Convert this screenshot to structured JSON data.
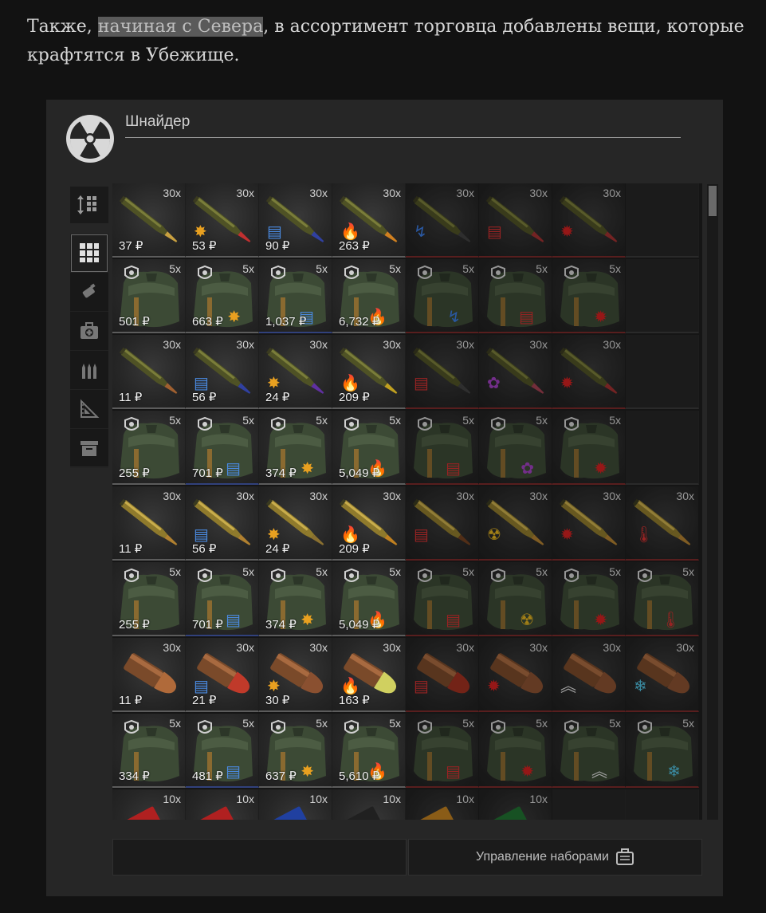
{
  "article": {
    "pre": "Также, ",
    "highlight": "начиная с Севера",
    "post": ", в ассортимент торговца добавлены вещи, которые крафтятся в Убежище."
  },
  "trader": {
    "name": "Шнайдер",
    "logo_icon": "radiation-icon"
  },
  "sidebar": {
    "sort_icon": "sort-grid-icon",
    "categories": [
      {
        "icon": "all-grid-icon",
        "active": true
      },
      {
        "icon": "grenade-icon",
        "active": false
      },
      {
        "icon": "medkit-icon",
        "active": false
      },
      {
        "icon": "ammo-icon",
        "active": false
      },
      {
        "icon": "tools-icon",
        "active": false
      },
      {
        "icon": "box-icon",
        "active": false
      }
    ]
  },
  "grid_rows": [
    {
      "cells": [
        {
          "kind": "cart",
          "qty": "30x",
          "price": "37 ₽",
          "tip": "#c8a040",
          "mod": ""
        },
        {
          "kind": "cart",
          "qty": "30x",
          "price": "53 ₽",
          "tip": "#c03030",
          "mod": "spark"
        },
        {
          "kind": "cart",
          "qty": "30x",
          "price": "90 ₽",
          "tip": "#3040a0",
          "mod": "armor"
        },
        {
          "kind": "cart",
          "qty": "30x",
          "price": "263 ₽",
          "tip": "#d08020",
          "mod": "fire"
        },
        {
          "kind": "cart",
          "qty": "30x",
          "price": "",
          "tip": "#404040",
          "mod": "shock",
          "dim": true
        },
        {
          "kind": "cart",
          "qty": "30x",
          "price": "",
          "tip": "#a03030",
          "mod": "armor-red",
          "dim": true
        },
        {
          "kind": "cart",
          "qty": "30x",
          "price": "",
          "tip": "#a03030",
          "mod": "bleed",
          "dim": true
        },
        {
          "kind": "empty"
        }
      ]
    },
    {
      "cells": [
        {
          "kind": "pack",
          "qty": "5x",
          "price": "501 ₽",
          "mod": ""
        },
        {
          "kind": "pack",
          "qty": "5x",
          "price": "663 ₽",
          "mod": "spark"
        },
        {
          "kind": "pack",
          "qty": "5x",
          "price": "1,037 ₽",
          "mod": "armor"
        },
        {
          "kind": "pack",
          "qty": "5x",
          "price": "6,732 ₽",
          "mod": "fire"
        },
        {
          "kind": "pack",
          "qty": "5x",
          "price": "",
          "mod": "shock",
          "dim": true
        },
        {
          "kind": "pack",
          "qty": "5x",
          "price": "",
          "mod": "armor-red",
          "dim": true
        },
        {
          "kind": "pack",
          "qty": "5x",
          "price": "",
          "mod": "bleed",
          "dim": true
        },
        {
          "kind": "empty"
        }
      ]
    },
    {
      "cells": [
        {
          "kind": "cart",
          "qty": "30x",
          "price": "11 ₽",
          "tip": "#a06030",
          "mod": ""
        },
        {
          "kind": "cart",
          "qty": "30x",
          "price": "56 ₽",
          "tip": "#3040a0",
          "mod": "armor"
        },
        {
          "kind": "cart",
          "qty": "30x",
          "price": "24 ₽",
          "tip": "#6030a0",
          "mod": "spark"
        },
        {
          "kind": "cart",
          "qty": "30x",
          "price": "209 ₽",
          "tip": "#c0a020",
          "mod": "fire"
        },
        {
          "kind": "cart",
          "qty": "30x",
          "price": "",
          "tip": "#404040",
          "mod": "armor-red",
          "dim": true
        },
        {
          "kind": "cart",
          "qty": "30x",
          "price": "",
          "tip": "#a04050",
          "mod": "brain",
          "dim": true
        },
        {
          "kind": "cart",
          "qty": "30x",
          "price": "",
          "tip": "#a03030",
          "mod": "bleed",
          "dim": true
        },
        {
          "kind": "empty"
        }
      ]
    },
    {
      "cells": [
        {
          "kind": "pack",
          "qty": "5x",
          "price": "255 ₽",
          "mod": ""
        },
        {
          "kind": "pack",
          "qty": "5x",
          "price": "701 ₽",
          "mod": "armor"
        },
        {
          "kind": "pack",
          "qty": "5x",
          "price": "374 ₽",
          "mod": "spark"
        },
        {
          "kind": "pack",
          "qty": "5x",
          "price": "5,049 ₽",
          "mod": "fire"
        },
        {
          "kind": "pack",
          "qty": "5x",
          "price": "",
          "mod": "armor-red",
          "dim": true
        },
        {
          "kind": "pack",
          "qty": "5x",
          "price": "",
          "mod": "brain",
          "dim": true
        },
        {
          "kind": "pack",
          "qty": "5x",
          "price": "",
          "mod": "bleed",
          "dim": true
        },
        {
          "kind": "empty"
        }
      ]
    },
    {
      "cells": [
        {
          "kind": "brass",
          "qty": "30x",
          "price": "11 ₽",
          "tip": "#b08030",
          "mod": ""
        },
        {
          "kind": "brass",
          "qty": "30x",
          "price": "56 ₽",
          "tip": "#b08030",
          "mod": "armor"
        },
        {
          "kind": "brass",
          "qty": "30x",
          "price": "24 ₽",
          "tip": "#8a7030",
          "mod": "spark"
        },
        {
          "kind": "brass",
          "qty": "30x",
          "price": "209 ₽",
          "tip": "#c08020",
          "mod": "fire"
        },
        {
          "kind": "brass",
          "qty": "30x",
          "price": "",
          "tip": "#704020",
          "mod": "armor-red",
          "dim": true
        },
        {
          "kind": "brass",
          "qty": "30x",
          "price": "",
          "tip": "#b08030",
          "mod": "radiation",
          "dim": true
        },
        {
          "kind": "brass",
          "qty": "30x",
          "price": "",
          "tip": "#b08030",
          "mod": "bleed",
          "dim": true
        },
        {
          "kind": "brass",
          "qty": "30x",
          "price": "",
          "tip": "#b08030",
          "mod": "heat",
          "dim": true
        }
      ]
    },
    {
      "cells": [
        {
          "kind": "pack",
          "qty": "5x",
          "price": "255 ₽",
          "mod": ""
        },
        {
          "kind": "pack",
          "qty": "5x",
          "price": "701 ₽",
          "mod": "armor"
        },
        {
          "kind": "pack",
          "qty": "5x",
          "price": "374 ₽",
          "mod": "spark"
        },
        {
          "kind": "pack",
          "qty": "5x",
          "price": "5,049 ₽",
          "mod": "fire"
        },
        {
          "kind": "pack",
          "qty": "5x",
          "price": "",
          "mod": "armor-red",
          "dim": true
        },
        {
          "kind": "pack",
          "qty": "5x",
          "price": "",
          "mod": "radiation",
          "dim": true
        },
        {
          "kind": "pack",
          "qty": "5x",
          "price": "",
          "mod": "bleed",
          "dim": true
        },
        {
          "kind": "pack",
          "qty": "5x",
          "price": "",
          "mod": "heat",
          "dim": true
        }
      ]
    },
    {
      "cells": [
        {
          "kind": "pistol",
          "qty": "30x",
          "price": "11 ₽",
          "tip": "#b06a3a",
          "mod": ""
        },
        {
          "kind": "pistol",
          "qty": "30x",
          "price": "21 ₽",
          "tip": "#c03a2a",
          "mod": "armor"
        },
        {
          "kind": "pistol",
          "qty": "30x",
          "price": "30 ₽",
          "tip": "#8a5030",
          "mod": "spark"
        },
        {
          "kind": "pistol",
          "qty": "30x",
          "price": "163 ₽",
          "tip": "#d0d060",
          "mod": "fire"
        },
        {
          "kind": "pistol",
          "qty": "30x",
          "price": "",
          "tip": "#a03020",
          "mod": "armor-red",
          "dim": true
        },
        {
          "kind": "pistol",
          "qty": "30x",
          "price": "",
          "tip": "#8a5030",
          "mod": "bleed",
          "dim": true
        },
        {
          "kind": "pistol",
          "qty": "30x",
          "price": "",
          "tip": "#8a5030",
          "mod": "rank",
          "dim": true
        },
        {
          "kind": "pistol",
          "qty": "30x",
          "price": "",
          "tip": "#8a5030",
          "mod": "frost",
          "dim": true
        }
      ]
    },
    {
      "cells": [
        {
          "kind": "pack",
          "qty": "5x",
          "price": "334 ₽",
          "mod": ""
        },
        {
          "kind": "pack",
          "qty": "5x",
          "price": "481 ₽",
          "mod": "armor"
        },
        {
          "kind": "pack",
          "qty": "5x",
          "price": "637 ₽",
          "mod": "spark"
        },
        {
          "kind": "pack",
          "qty": "5x",
          "price": "5,610 ₽",
          "mod": "fire"
        },
        {
          "kind": "pack",
          "qty": "5x",
          "price": "",
          "mod": "armor-red",
          "dim": true
        },
        {
          "kind": "pack",
          "qty": "5x",
          "price": "",
          "mod": "bleed",
          "dim": true
        },
        {
          "kind": "pack",
          "qty": "5x",
          "price": "",
          "mod": "rank",
          "dim": true
        },
        {
          "kind": "pack",
          "qty": "5x",
          "price": "",
          "mod": "frost",
          "dim": true
        }
      ]
    },
    {
      "cells": [
        {
          "kind": "shell",
          "qty": "10x",
          "price": "",
          "tip": "#b02020",
          "mod": ""
        },
        {
          "kind": "shell",
          "qty": "10x",
          "price": "",
          "tip": "#b02020",
          "mod": ""
        },
        {
          "kind": "shell",
          "qty": "10x",
          "price": "",
          "tip": "#2040a0",
          "mod": ""
        },
        {
          "kind": "shell",
          "qty": "10x",
          "price": "",
          "tip": "#202020",
          "mod": ""
        },
        {
          "kind": "shell",
          "qty": "10x",
          "price": "",
          "tip": "#c08020",
          "mod": "",
          "dim": true
        },
        {
          "kind": "shell",
          "qty": "10x",
          "price": "",
          "tip": "#207030",
          "mod": "",
          "dim": true
        },
        {
          "kind": "empty"
        },
        {
          "kind": "empty"
        }
      ]
    }
  ],
  "footer": {
    "kits_label": "Управление наборами",
    "kits_icon": "briefcase-icon"
  }
}
